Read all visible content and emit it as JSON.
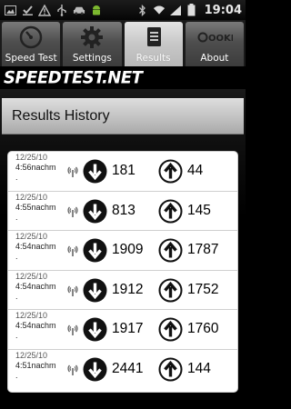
{
  "statusbar": {
    "time": "19:04",
    "icons": [
      "gallery-icon",
      "download-done-icon",
      "warning-icon",
      "usb-icon",
      "car-icon",
      "android-icon",
      "bluetooth-icon",
      "wifi-icon",
      "signal-icon",
      "battery-icon"
    ]
  },
  "tabs": [
    {
      "label": "Speed Test",
      "icon": "speedometer-icon",
      "active": false
    },
    {
      "label": "Settings",
      "icon": "gear-icon",
      "active": false
    },
    {
      "label": "Results",
      "icon": "document-icon",
      "active": true
    },
    {
      "label": "About",
      "icon": "ookla-icon",
      "active": false
    }
  ],
  "about_icon_text": "OOKLA",
  "logo": {
    "text": "SPEEDTEST.NET"
  },
  "header": {
    "title": "Results History"
  },
  "results": [
    {
      "date": "12/25/10",
      "time": "4:56nachm",
      "extra": ".",
      "download": "181",
      "upload": "44"
    },
    {
      "date": "12/25/10",
      "time": "4:55nachm",
      "extra": ".",
      "download": "813",
      "upload": "145"
    },
    {
      "date": "12/25/10",
      "time": "4:54nachm",
      "extra": ".",
      "download": "1909",
      "upload": "1787"
    },
    {
      "date": "12/25/10",
      "time": "4:54nachm",
      "extra": ".",
      "download": "1912",
      "upload": "1752"
    },
    {
      "date": "12/25/10",
      "time": "4:54nachm",
      "extra": ".",
      "download": "1917",
      "upload": "1760"
    },
    {
      "date": "12/25/10",
      "time": "4:51nachm",
      "extra": ".",
      "download": "2441",
      "upload": "144"
    }
  ],
  "colors": {
    "accent": "#000000",
    "header_bg": "#c8c8c8",
    "list_bg": "#ffffff"
  }
}
